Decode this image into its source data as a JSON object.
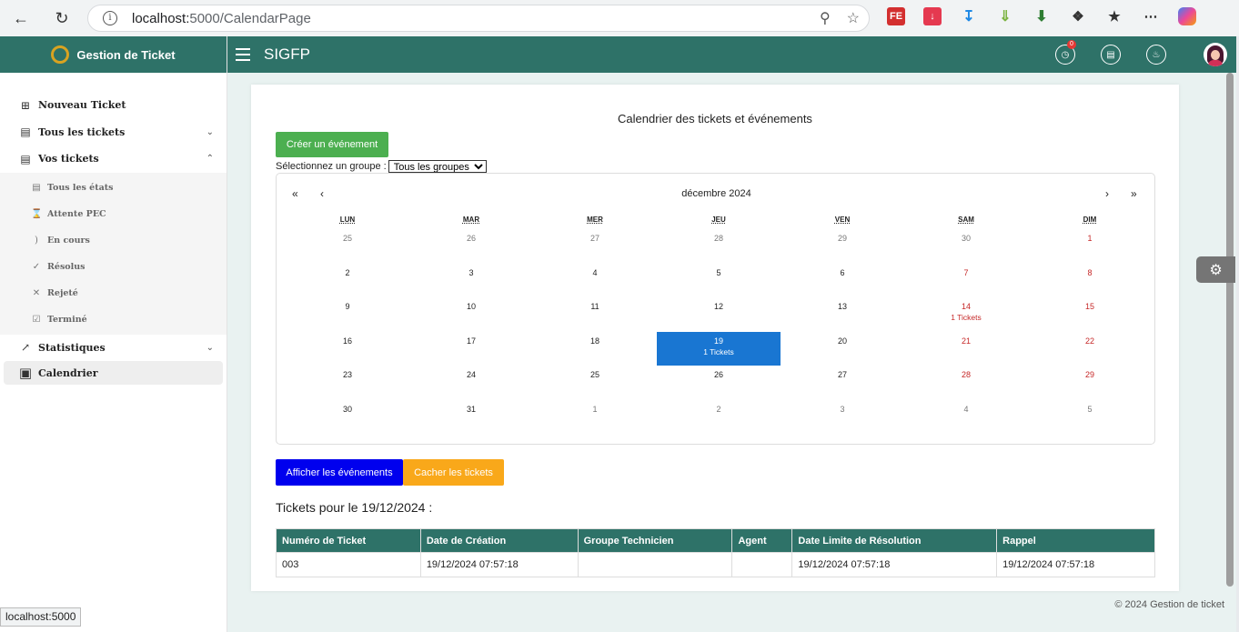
{
  "browser": {
    "url_host": "localhost:",
    "url_path": "5000/CalendarPage",
    "status_tip": "localhost:5000"
  },
  "sidebar": {
    "brand": "Gestion de Ticket",
    "items": [
      {
        "label": "Nouveau Ticket",
        "icon": "add-box-icon"
      },
      {
        "label": "Tous les tickets",
        "icon": "ticket-icon"
      },
      {
        "label": "Vos tickets",
        "icon": "ticket-icon"
      }
    ],
    "subitems": [
      {
        "label": "Tous les états",
        "icon": "list-icon"
      },
      {
        "label": "Attente PEC",
        "icon": "hourglass-icon"
      },
      {
        "label": "En cours",
        "icon": "progress-icon"
      },
      {
        "label": "Résolus",
        "icon": "check-icon"
      },
      {
        "label": "Rejeté",
        "icon": "close-icon"
      },
      {
        "label": "Terminé",
        "icon": "checkbox-icon"
      }
    ],
    "bottom_items": [
      {
        "label": "Statistiques",
        "icon": "chart-icon"
      },
      {
        "label": "Calendrier",
        "icon": "calendar-icon"
      }
    ]
  },
  "topbar": {
    "title": "SIGFP",
    "history_badge": "0"
  },
  "main": {
    "card_title": "Calendrier des tickets et événements",
    "create_button": "Créer un événement",
    "group_label": "Sélectionnez un groupe :",
    "group_selected": "Tous les groupes",
    "calendar": {
      "nav_prev2": "«",
      "nav_prev": "‹",
      "nav_next": "›",
      "nav_next2": "»",
      "month": "décembre 2024",
      "weekdays": [
        "LUN",
        "MAR",
        "MER",
        "JEU",
        "VEN",
        "SAM",
        "DIM"
      ],
      "weeks": [
        [
          {
            "d": "25",
            "o": true
          },
          {
            "d": "26",
            "o": true
          },
          {
            "d": "27",
            "o": true
          },
          {
            "d": "28",
            "o": true
          },
          {
            "d": "29",
            "o": true
          },
          {
            "d": "30",
            "o": true
          },
          {
            "d": "1",
            "w": true
          }
        ],
        [
          {
            "d": "2"
          },
          {
            "d": "3"
          },
          {
            "d": "4"
          },
          {
            "d": "5"
          },
          {
            "d": "6"
          },
          {
            "d": "7",
            "w": true
          },
          {
            "d": "8",
            "w": true
          }
        ],
        [
          {
            "d": "9"
          },
          {
            "d": "10"
          },
          {
            "d": "11"
          },
          {
            "d": "12"
          },
          {
            "d": "13"
          },
          {
            "d": "14",
            "w": true,
            "t": "1 Tickets"
          },
          {
            "d": "15",
            "w": true
          }
        ],
        [
          {
            "d": "16"
          },
          {
            "d": "17"
          },
          {
            "d": "18"
          },
          {
            "d": "19",
            "today": true,
            "t": "1 Tickets"
          },
          {
            "d": "20"
          },
          {
            "d": "21",
            "w": true
          },
          {
            "d": "22",
            "w": true
          }
        ],
        [
          {
            "d": "23"
          },
          {
            "d": "24"
          },
          {
            "d": "25"
          },
          {
            "d": "26"
          },
          {
            "d": "27"
          },
          {
            "d": "28",
            "w": true
          },
          {
            "d": "29",
            "w": true
          }
        ],
        [
          {
            "d": "30"
          },
          {
            "d": "31"
          },
          {
            "d": "1",
            "o": true
          },
          {
            "d": "2",
            "o": true
          },
          {
            "d": "3",
            "o": true
          },
          {
            "d": "4",
            "o": true
          },
          {
            "d": "5",
            "o": true
          }
        ]
      ]
    },
    "show_events_button": "Afficher les événements",
    "hide_tickets_button": "Cacher les tickets",
    "tickets_heading": "Tickets pour le 19/12/2024 :",
    "table": {
      "headers": [
        "Numéro de Ticket",
        "Date de Création",
        "Groupe Technicien",
        "Agent",
        "Date Limite de Résolution",
        "Rappel"
      ],
      "rows": [
        [
          "003",
          "19/12/2024 07:57:18",
          "",
          "",
          "19/12/2024 07:57:18",
          "19/12/2024 07:57:18"
        ]
      ]
    },
    "footer": "© 2024 Gestion de ticket"
  },
  "colors": {
    "primary": "#2e7268",
    "create": "#4caf50",
    "events": "#0000ee",
    "hide": "#f9a81a",
    "today": "#1976d2",
    "weekend": "#c62828"
  }
}
